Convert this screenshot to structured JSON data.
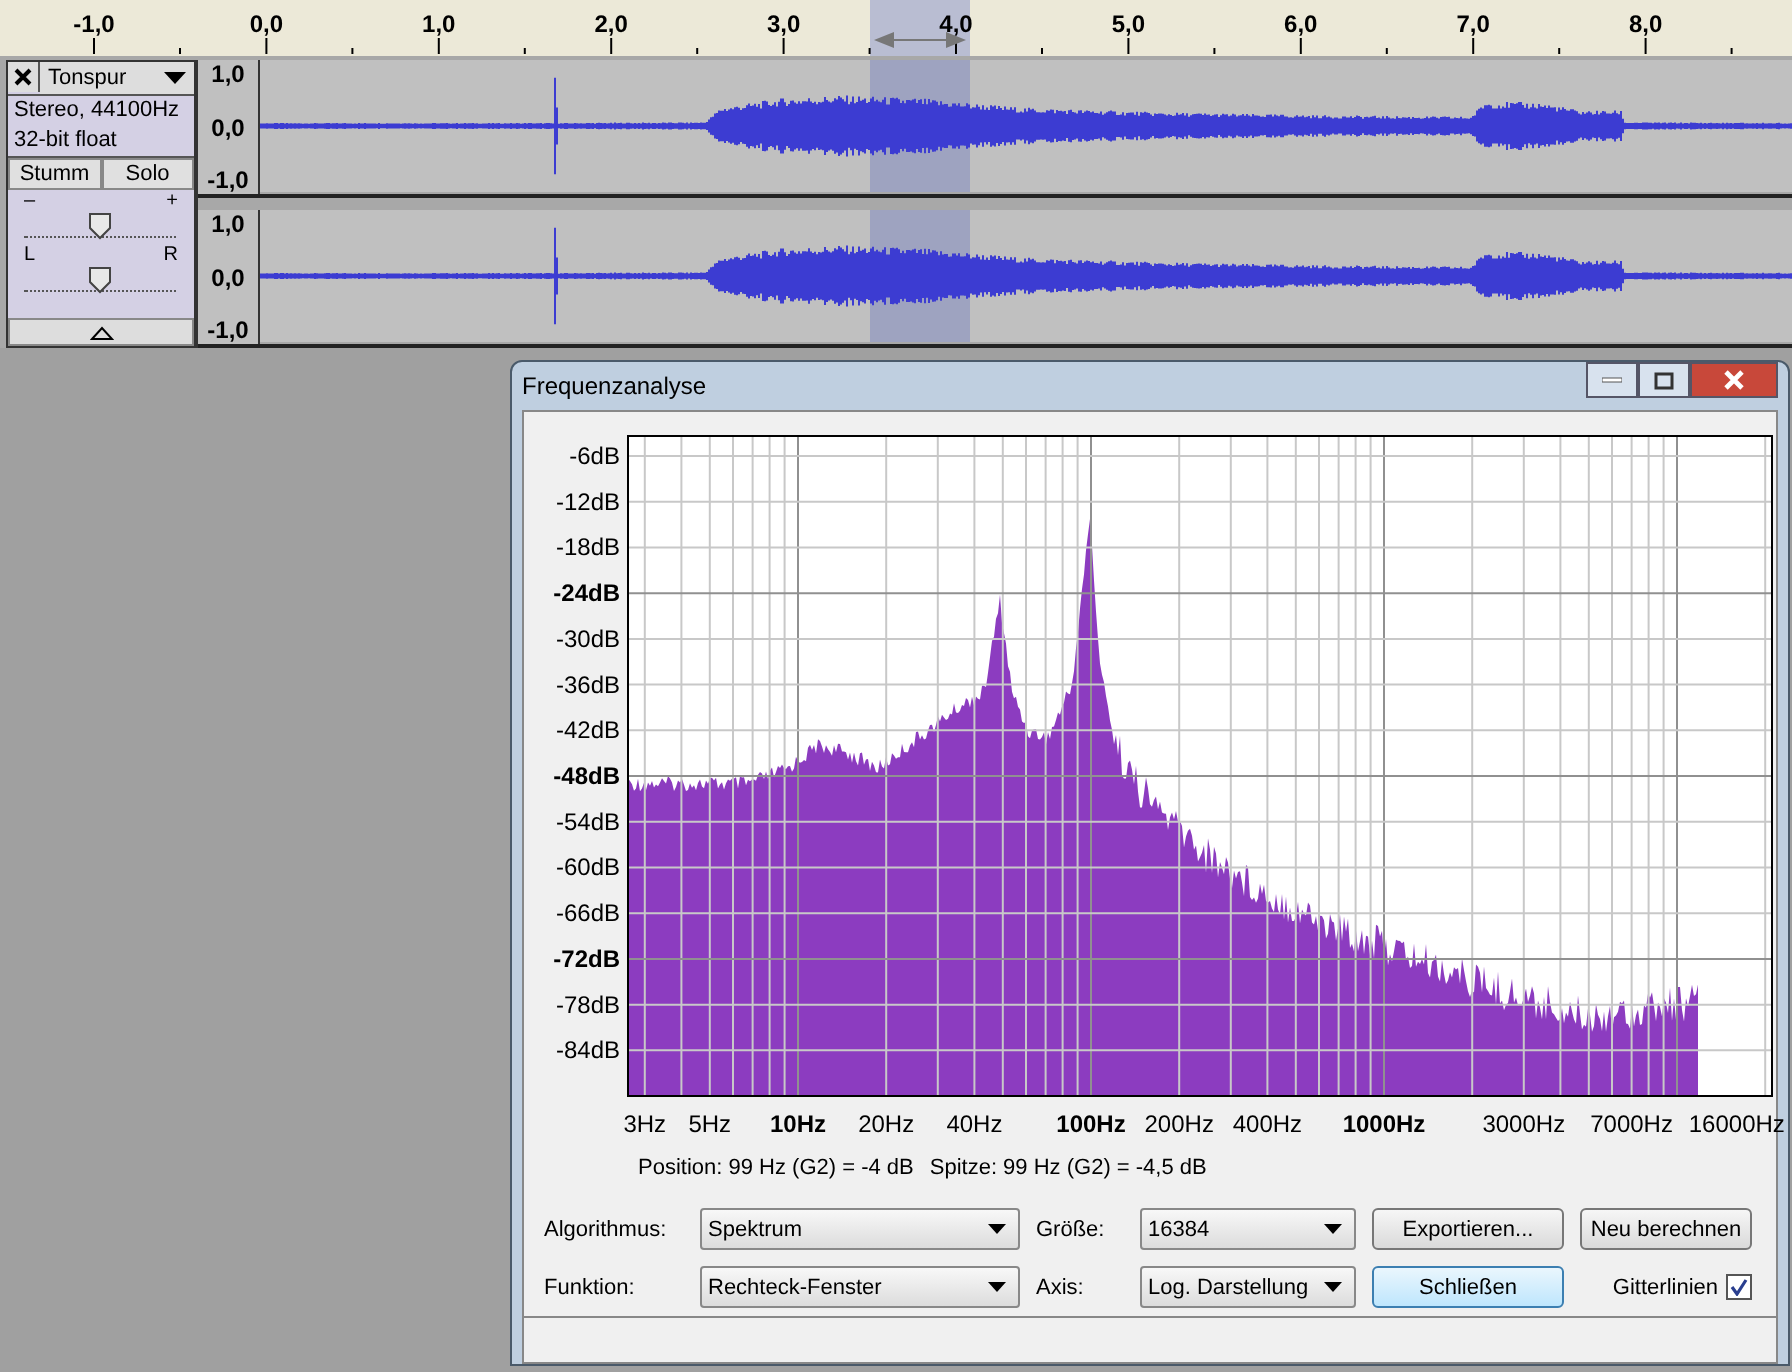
{
  "ruler": {
    "ticks": [
      "-1,0",
      "0,0",
      "1,0",
      "2,0",
      "3,0",
      "4,0",
      "5,0",
      "6,0",
      "7,0",
      "8,0"
    ]
  },
  "track": {
    "name": "Tonspur",
    "info": [
      "Stereo, 44100Hz",
      "32-bit float"
    ],
    "buttons": [
      {
        "label": "Stumm",
        "selected": false
      },
      {
        "label": "Solo",
        "selected": false
      }
    ],
    "gain": {
      "minus": "–",
      "plus": "+",
      "level": 0.5
    },
    "pan": {
      "left": "L",
      "right": "R",
      "level": 0.5
    },
    "channels": [
      {
        "scale": [
          "1,0",
          "0,0",
          "-1,0"
        ]
      },
      {
        "scale": [
          "1,0",
          "0,0",
          "-1,0"
        ]
      }
    ]
  },
  "dialog": {
    "title": "Frequenzanalyse",
    "y_ticks": [
      {
        "label": "-6dB",
        "major": false
      },
      {
        "label": "-12dB",
        "major": false
      },
      {
        "label": "-18dB",
        "major": false
      },
      {
        "label": "-24dB",
        "major": true
      },
      {
        "label": "-30dB",
        "major": false
      },
      {
        "label": "-36dB",
        "major": false
      },
      {
        "label": "-42dB",
        "major": false
      },
      {
        "label": "-48dB",
        "major": true
      },
      {
        "label": "-54dB",
        "major": false
      },
      {
        "label": "-60dB",
        "major": false
      },
      {
        "label": "-66dB",
        "major": false
      },
      {
        "label": "-72dB",
        "major": true
      },
      {
        "label": "-78dB",
        "major": false
      },
      {
        "label": "-84dB",
        "major": false
      }
    ],
    "x_ticks": [
      {
        "label": "3Hz",
        "major": false
      },
      {
        "label": "5Hz",
        "major": false
      },
      {
        "label": "10Hz",
        "major": true
      },
      {
        "label": "20Hz",
        "major": false
      },
      {
        "label": "40Hz",
        "major": false
      },
      {
        "label": "100Hz",
        "major": true
      },
      {
        "label": "200Hz",
        "major": false
      },
      {
        "label": "400Hz",
        "major": false
      },
      {
        "label": "1000Hz",
        "major": true
      },
      {
        "label": "3000Hz",
        "major": false
      },
      {
        "label": "7000Hz",
        "major": false
      },
      {
        "label": "16000Hz",
        "major": false
      }
    ],
    "readouts": [
      "Position: 99 Hz (G2) = -4 dB",
      "Spitze: 99 Hz (G2) = -4,5 dB"
    ],
    "fields": [
      {
        "label": "Algorithmus:",
        "value": "Spektrum"
      },
      {
        "label": "Größe:",
        "value": "16384"
      },
      {
        "label": "Funktion:",
        "value": "Rechteck-Fenster"
      },
      {
        "label": "Axis:",
        "value": "Log. Darstellung"
      }
    ],
    "buttons": [
      {
        "label": "Exportieren...",
        "default": false
      },
      {
        "label": "Neu berechnen",
        "default": false
      },
      {
        "label": "Schließen",
        "default": true
      }
    ],
    "gridlines": {
      "label": "Gitterlinien",
      "checked": true
    }
  }
}
